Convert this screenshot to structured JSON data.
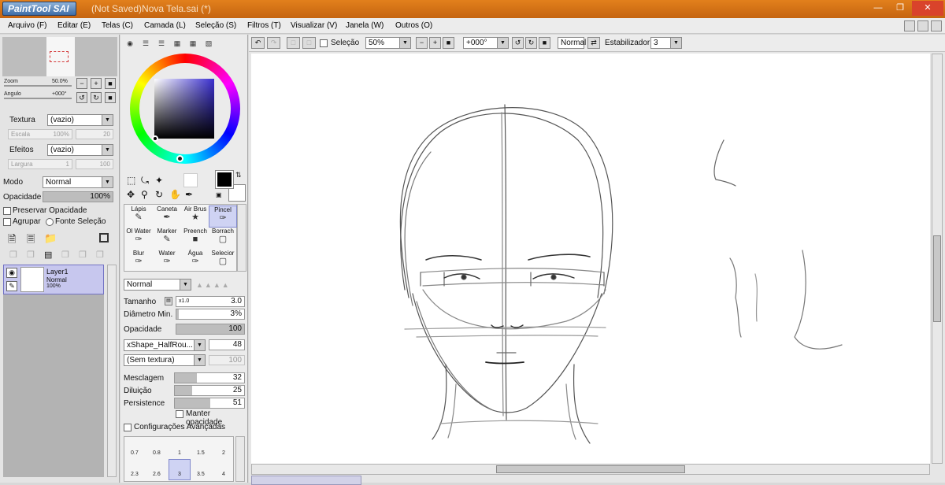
{
  "app": {
    "logo_text": "PaintTool SAI",
    "title": "(Not Saved)Nova Tela.sai (*)"
  },
  "menu": [
    "Arquivo (F)",
    "Editar (E)",
    "Telas (C)",
    "Camada (L)",
    "Seleção (S)",
    "Filtros (T)",
    "Visualizar (V)",
    "Janela (W)",
    "Outros (O)"
  ],
  "navigator": {
    "zoom_label": "Zoom",
    "zoom_value": "50.0%",
    "angle_label": "Angulo",
    "angle_value": "+000°"
  },
  "texture": {
    "label": "Textura",
    "value": "(vazio)",
    "scale_label": "Escala",
    "scale_value": "100%",
    "scale_num": "20"
  },
  "effects": {
    "label": "Efeitos",
    "value": "(vazio)",
    "width_label": "Largura",
    "width_value": "1",
    "width_num": "100"
  },
  "mode": {
    "label": "Modo",
    "value": "Normal"
  },
  "opacity": {
    "label": "Opacidade",
    "value": "100%",
    "fraction": 1.0
  },
  "options": {
    "preserve": "Preservar Opacidade",
    "group": "Agrupar",
    "source": "Fonte Seleção"
  },
  "layer": {
    "name": "Layer1",
    "mode": "Normal",
    "opacity": "100%"
  },
  "tools": [
    {
      "label": "Lápis",
      "glyph": "✎"
    },
    {
      "label": "Caneta",
      "glyph": "✒"
    },
    {
      "label": "Air Brus",
      "glyph": "★"
    },
    {
      "label": "Pincel",
      "glyph": "✑"
    },
    {
      "label": "Ol Water",
      "glyph": "✑"
    },
    {
      "label": "Marker",
      "glyph": "✎"
    },
    {
      "label": "Preench",
      "glyph": "■"
    },
    {
      "label": "Borrach",
      "glyph": "▢"
    },
    {
      "label": "Blur",
      "glyph": "✑"
    },
    {
      "label": "Water",
      "glyph": "✑"
    },
    {
      "label": "Água",
      "glyph": "✑"
    },
    {
      "label": "Selecior",
      "glyph": "▢"
    }
  ],
  "brush": {
    "mode": "Normal",
    "size_label": "Tamanho",
    "size_mult": "x1.0",
    "size_value": "3.0",
    "min_diam_label": "Diâmetro Min.",
    "min_diam_value": "3%",
    "opacity_label": "Opacidade",
    "opacity_value": "100",
    "shape": "xShape_HalfRou...",
    "shape_value": "48",
    "texture": "(Sem textura)",
    "texture_value": "100",
    "blend_label": "Mesclagem",
    "blend_value": "32",
    "dilution_label": "Diluição",
    "dilution_value": "25",
    "persistence_label": "Persistence",
    "persistence_value": "51",
    "keep_opacity": "Manter opacidade",
    "advanced": "Configurações Avançadas"
  },
  "size_presets": {
    "row1": [
      "0.7",
      "0.8",
      "1",
      "1.5",
      "2"
    ],
    "row2": [
      "2.3",
      "2.6",
      "3",
      "3.5",
      "4"
    ]
  },
  "canvas_toolbar": {
    "selection_label": "Seleção",
    "zoom": "50%",
    "angle": "+000°",
    "blend": "Normal",
    "stabilizer_label": "Estabilizador",
    "stabilizer_value": "3"
  },
  "colors": {
    "accent": "#d9791c",
    "current_color": "#000000",
    "selected_tool_bg": "#cfd3f3"
  }
}
